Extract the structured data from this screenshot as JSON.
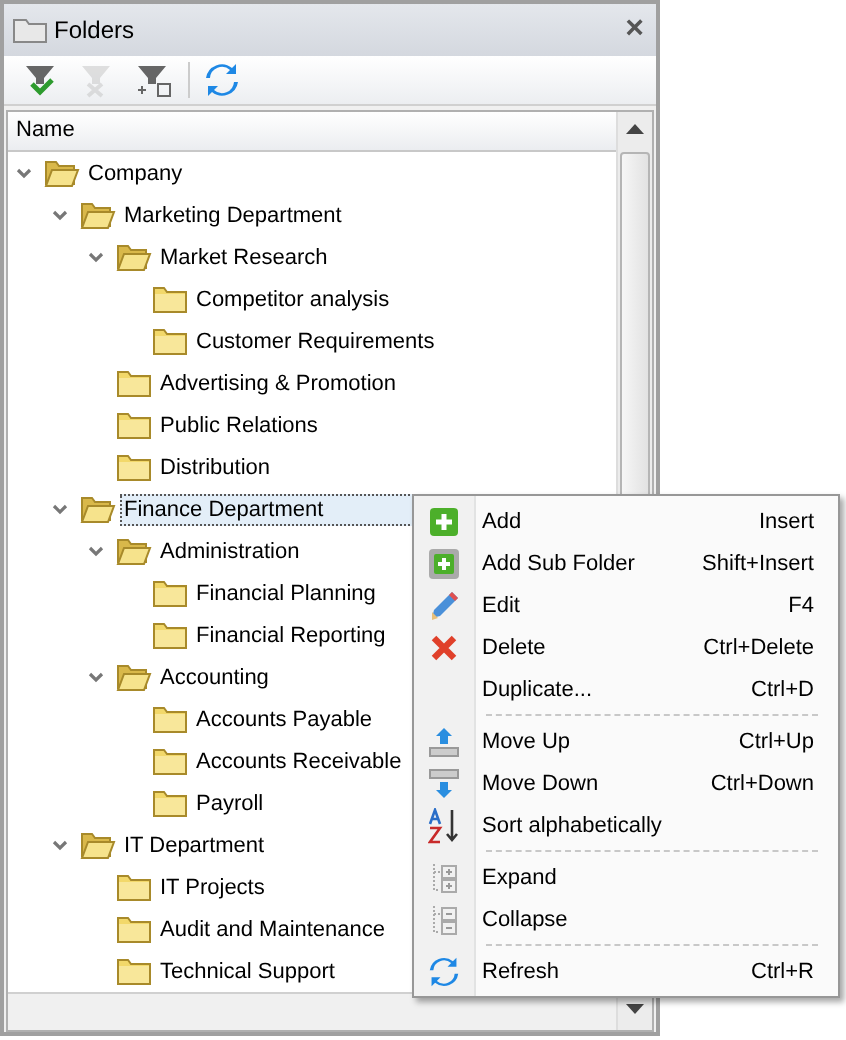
{
  "panel": {
    "title": "Folders",
    "close": "×"
  },
  "toolbar": [
    {
      "disabled": false
    },
    {
      "disabled": true
    },
    {
      "disabled": false
    },
    {
      "disabled": false
    }
  ],
  "tree": {
    "column": "Name",
    "items": [
      {
        "label": "Company",
        "expanded": true,
        "selected": false,
        "children": [
          {
            "label": "Marketing Department",
            "expanded": true,
            "selected": false,
            "children": [
              {
                "label": "Market Research",
                "expanded": true,
                "selected": false,
                "children": [
                  {
                    "label": "Competitor analysis",
                    "selected": false
                  },
                  {
                    "label": "Customer Requirements",
                    "selected": false
                  }
                ]
              },
              {
                "label": "Advertising & Promotion",
                "selected": false
              },
              {
                "label": "Public Relations",
                "selected": false
              },
              {
                "label": "Distribution",
                "selected": false
              }
            ]
          },
          {
            "label": "Finance Department",
            "expanded": true,
            "selected": true,
            "children": [
              {
                "label": "Administration",
                "expanded": true,
                "selected": false,
                "children": [
                  {
                    "label": "Financial Planning",
                    "selected": false
                  },
                  {
                    "label": "Financial Reporting",
                    "selected": false
                  }
                ]
              },
              {
                "label": "Accounting",
                "expanded": true,
                "selected": false,
                "children": [
                  {
                    "label": "Accounts Payable",
                    "selected": false
                  },
                  {
                    "label": "Accounts Receivable",
                    "selected": false
                  },
                  {
                    "label": "Payroll",
                    "selected": false
                  }
                ]
              }
            ]
          },
          {
            "label": "IT Department",
            "expanded": true,
            "selected": false,
            "children": [
              {
                "label": "IT Projects",
                "selected": false
              },
              {
                "label": "Audit and Maintenance",
                "selected": false
              },
              {
                "label": "Technical Support",
                "selected": false
              }
            ]
          }
        ]
      }
    ]
  },
  "context_menu": [
    {
      "kind": "item",
      "label": "Add",
      "shortcut": "Insert"
    },
    {
      "kind": "item",
      "label": "Add Sub Folder",
      "shortcut": "Shift+Insert"
    },
    {
      "kind": "item",
      "label": "Edit",
      "shortcut": "F4"
    },
    {
      "kind": "item",
      "label": "Delete",
      "shortcut": "Ctrl+Delete"
    },
    {
      "kind": "item",
      "label": "Duplicate...",
      "shortcut": "Ctrl+D"
    },
    {
      "kind": "separator"
    },
    {
      "kind": "item",
      "label": "Move Up",
      "shortcut": "Ctrl+Up"
    },
    {
      "kind": "item",
      "label": "Move Down",
      "shortcut": "Ctrl+Down"
    },
    {
      "kind": "item",
      "label": "Sort alphabetically"
    },
    {
      "kind": "separator"
    },
    {
      "kind": "item",
      "label": "Expand"
    },
    {
      "kind": "item",
      "label": "Collapse"
    },
    {
      "kind": "separator"
    },
    {
      "kind": "item",
      "label": "Refresh",
      "shortcut": "Ctrl+R"
    }
  ]
}
